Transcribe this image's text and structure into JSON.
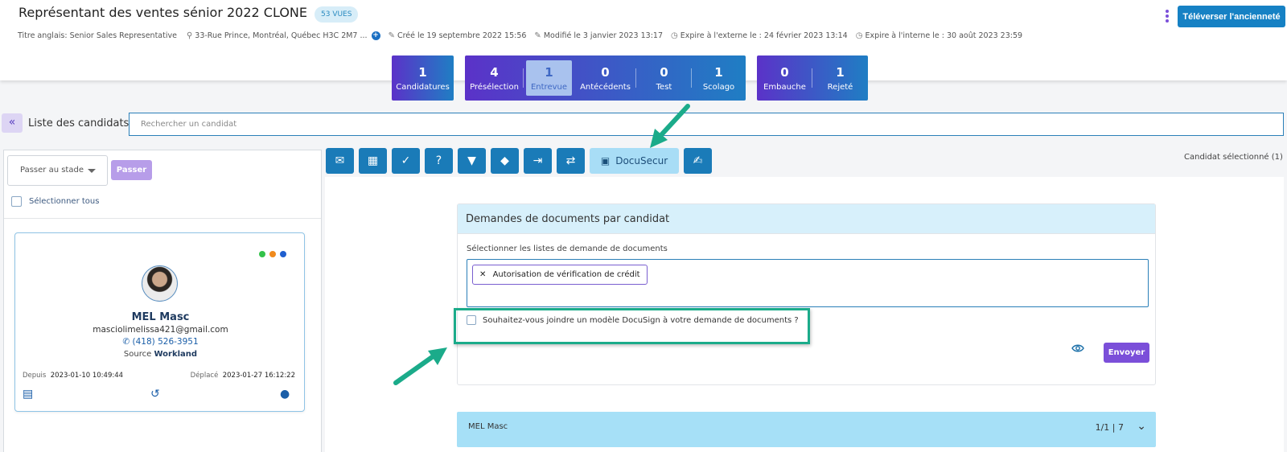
{
  "header": {
    "job_title": "Représentant des ventes sénior 2022 CLONE",
    "views_badge": "53 VUES",
    "upload_button": "Téléverser l'ancienneté",
    "english_title": "Titre anglais: Senior Sales Representative",
    "address": "33-Rue Prince, Montréal, Québec H3C 2M7 ...",
    "created": "Créé le 19 septembre 2022 15:56",
    "modified": "Modifié le 3 janvier 2023 13:17",
    "expires_external": "Expire à l'externe le : 24 février 2023 13:14",
    "expires_internal": "Expire à l'interne le : 30 août 2023 23:59"
  },
  "pipeline": {
    "group1": [
      {
        "count": "1",
        "label": "Candidatures"
      }
    ],
    "group2": [
      {
        "count": "4",
        "label": "Présélection"
      },
      {
        "count": "1",
        "label": "Entrevue"
      },
      {
        "count": "0",
        "label": "Antécédents"
      },
      {
        "count": "0",
        "label": "Test"
      },
      {
        "count": "1",
        "label": "Scolago"
      }
    ],
    "group3": [
      {
        "count": "0",
        "label": "Embauche"
      },
      {
        "count": "1",
        "label": "Rejeté"
      }
    ],
    "active_stage": "Entrevue"
  },
  "candidates": {
    "list_title": "Liste des candidats",
    "search_placeholder": "Rechercher un candidat",
    "stage_select": "Passer au stade",
    "pass_button": "Passer",
    "select_all": "Sélectionner tous"
  },
  "candidate_card": {
    "name": "MEL Masc",
    "email": "masciolimelissa421@gmail.com",
    "phone": "(418) 526-3951",
    "source_label": "Source",
    "source_value": "Workland",
    "since_label": "Depuis",
    "since_value": "2023-01-10 10:49:44",
    "moved_label": "Déplacé",
    "moved_value": "2023-01-27 16:12:22",
    "status_dots": [
      "#33c24a",
      "#f08a1c",
      "#1f5fcf"
    ]
  },
  "toolbar": {
    "docusecur_label": "DocuSecur",
    "selected_count": "Candidat sélectionné  (1)",
    "icons": [
      "envelope-icon",
      "calendar-plus-icon",
      "clipboard-check-icon",
      "clipboard-question-icon",
      "thumbs-down-icon",
      "tag-icon",
      "sign-out-icon",
      "exchange-icon",
      "docusecur-icon",
      "signature-icon"
    ]
  },
  "documents_panel": {
    "title": "Demandes de documents par candidat",
    "select_label": "Sélectionner les listes de demande de documents",
    "selected_tag": "Autorisation de vérification de crédit",
    "docusign_question": "Souhaitez-vous joindre un modèle DocuSign à votre demande de documents ?",
    "send_button": "Envoyer"
  },
  "candidate_bar": {
    "name": "MEL Masc",
    "counter": "1/1 | 7"
  },
  "colors": {
    "primary_blue": "#1681c4",
    "purple": "#7b4fd9",
    "annotation_green": "#1bab8a"
  }
}
